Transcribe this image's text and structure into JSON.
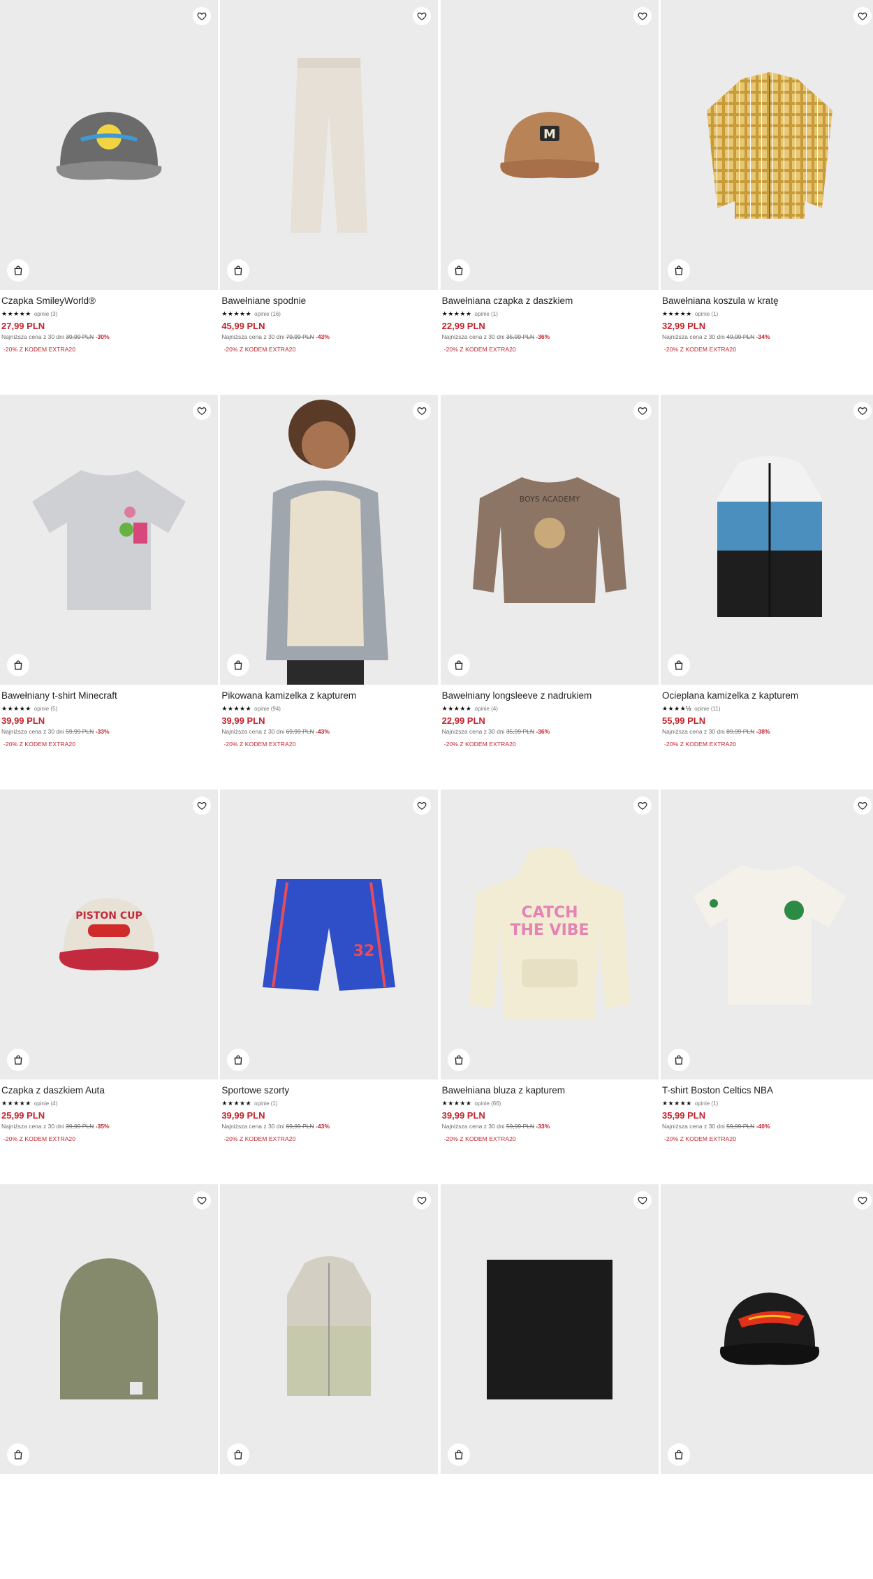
{
  "products": [
    {
      "name": "Czapka SmileyWorld®",
      "stars": "★★★★★",
      "reviews": "opinie (3)",
      "price": "27,99 PLN",
      "lowest_label": "Najniższa cena z 30 dni",
      "old_price": "39,99 PLN",
      "discount": "-30%",
      "promo": "-20% Z KODEM EXTRA20",
      "image": "cap-gray-smiley-icon"
    },
    {
      "name": "Bawełniane spodnie",
      "stars": "★★★★★",
      "reviews": "opinie (16)",
      "price": "45,99 PLN",
      "lowest_label": "Najniższa cena z 30 dni",
      "old_price": "79,99 PLN",
      "discount": "-43%",
      "promo": "-20% Z KODEM EXTRA20",
      "image": "pants-beige-icon"
    },
    {
      "name": "Bawełniana czapka z daszkiem",
      "stars": "★★★★★",
      "reviews": "opinie (1)",
      "price": "22,99 PLN",
      "lowest_label": "Najniższa cena z 30 dni",
      "old_price": "35,99 PLN",
      "discount": "-36%",
      "promo": "-20% Z KODEM EXTRA20",
      "image": "cap-brown-m-icon"
    },
    {
      "name": "Bawełniana koszula w kratę",
      "stars": "★★★★★",
      "reviews": "opinie (1)",
      "price": "32,99 PLN",
      "lowest_label": "Najniższa cena z 30 dni",
      "old_price": "49,99 PLN",
      "discount": "-34%",
      "promo": "-20% Z KODEM EXTRA20",
      "image": "shirt-plaid-icon"
    },
    {
      "name": "Bawełniany t-shirt Minecraft",
      "stars": "★★★★★",
      "reviews": "opinie (5)",
      "price": "39,99 PLN",
      "lowest_label": "Najniższa cena z 30 dni",
      "old_price": "59,99 PLN",
      "discount": "-33%",
      "promo": "-20% Z KODEM EXTRA20",
      "image": "tshirt-gray-icon"
    },
    {
      "name": "Pikowana kamizelka z kapturem",
      "stars": "★★★★★",
      "reviews": "opinie (94)",
      "price": "39,99 PLN",
      "lowest_label": "Najniższa cena z 30 dni",
      "old_price": "69,99 PLN",
      "discount": "-43%",
      "promo": "-20% Z KODEM EXTRA20",
      "image": "vest-cream-model-icon"
    },
    {
      "name": "Bawełniany longsleeve z nadrukiem",
      "stars": "★★★★★",
      "reviews": "opinie (4)",
      "price": "22,99 PLN",
      "lowest_label": "Najniższa cena z 30 dni",
      "old_price": "35,99 PLN",
      "discount": "-36%",
      "promo": "-20% Z KODEM EXTRA20",
      "image": "longsleeve-brown-icon"
    },
    {
      "name": "Ocieplana kamizelka z kapturem",
      "stars": "★★★★½",
      "reviews": "opinie (11)",
      "price": "55,99 PLN",
      "lowest_label": "Najniższa cena z 30 dni",
      "old_price": "89,99 PLN",
      "discount": "-38%",
      "promo": "-20% Z KODEM EXTRA20",
      "image": "vest-blue-black-icon"
    },
    {
      "name": "Czapka z daszkiem Auta",
      "stars": "★★★★★",
      "reviews": "opinie (4)",
      "price": "25,99 PLN",
      "lowest_label": "Najniższa cena z 30 dni",
      "old_price": "39,99 PLN",
      "discount": "-35%",
      "promo": "-20% Z KODEM EXTRA20",
      "image": "cap-cars-icon"
    },
    {
      "name": "Sportowe szorty",
      "stars": "★★★★★",
      "reviews": "opinie (1)",
      "price": "39,99 PLN",
      "lowest_label": "Najniższa cena z 30 dni",
      "old_price": "69,99 PLN",
      "discount": "-43%",
      "promo": "-20% Z KODEM EXTRA20",
      "image": "shorts-blue-icon"
    },
    {
      "name": "Bawełniana bluza z kapturem",
      "stars": "★★★★★",
      "reviews": "opinie (66)",
      "price": "39,99 PLN",
      "lowest_label": "Najniższa cena z 30 dni",
      "old_price": "59,99 PLN",
      "discount": "-33%",
      "promo": "-20% Z KODEM EXTRA20",
      "image": "hoodie-cream-icon"
    },
    {
      "name": "T-shirt Boston Celtics NBA",
      "stars": "★★★★★",
      "reviews": "opinie (1)",
      "price": "35,99 PLN",
      "lowest_label": "Najniższa cena z 30 dni",
      "old_price": "59,99 PLN",
      "discount": "-40%",
      "promo": "-20% Z KODEM EXTRA20",
      "image": "tshirt-white-celtics-icon"
    },
    {
      "image": "beanie-olive-icon"
    },
    {
      "image": "vest-olive-icon"
    },
    {
      "image": "scarf-black-icon"
    },
    {
      "image": "cap-black-hotwheels-icon"
    }
  ],
  "colors": {
    "price": "#c3232d",
    "image_bg": "#ebebeb"
  }
}
